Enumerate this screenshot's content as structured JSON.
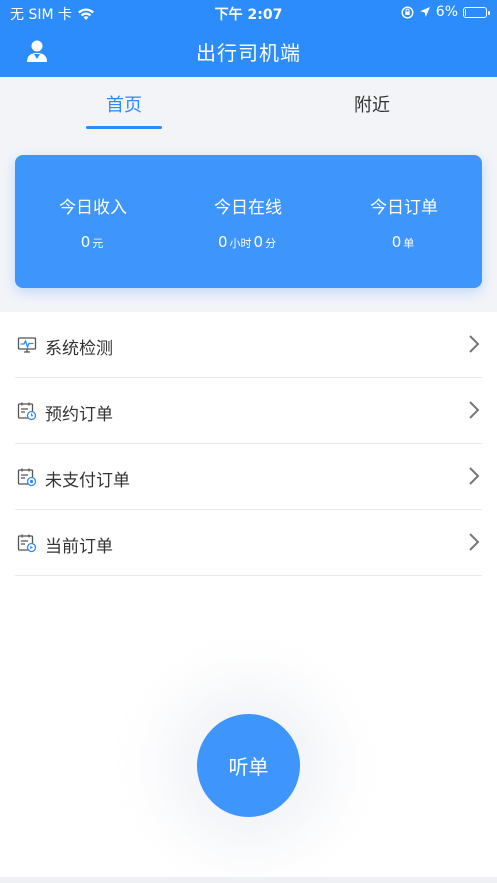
{
  "status_bar": {
    "carrier": "无 SIM 卡",
    "time": "下午 2:07",
    "battery": "6%",
    "battery_level": 0.06
  },
  "header": {
    "title": "出行司机端",
    "profile_icon": "user-icon"
  },
  "tabs": [
    {
      "label": "首页",
      "active": true
    },
    {
      "label": "附近",
      "active": false
    }
  ],
  "stats": [
    {
      "label": "今日收入",
      "value": "0",
      "unit": "元"
    },
    {
      "label": "今日在线",
      "hours": "0",
      "hours_unit": "小时",
      "minutes": "0",
      "minutes_unit": "分"
    },
    {
      "label": "今日订单",
      "value": "0",
      "unit": "单"
    }
  ],
  "menu": [
    {
      "label": "系统检测",
      "icon": "monitor-icon"
    },
    {
      "label": "预约订单",
      "icon": "calendar-clock-icon"
    },
    {
      "label": "未支付订单",
      "icon": "calendar-pay-icon"
    },
    {
      "label": "当前订单",
      "icon": "calendar-current-icon"
    }
  ],
  "listen_button": {
    "label": "听单"
  },
  "colors": {
    "primary": "#2d8cfb",
    "card": "#3e95fb"
  }
}
